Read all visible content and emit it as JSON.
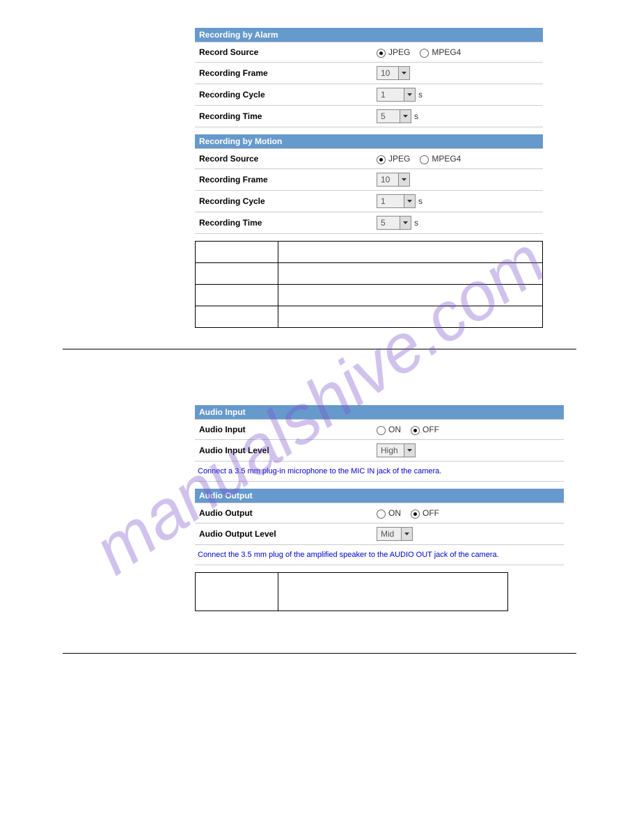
{
  "watermark": "manualshive.com",
  "section1": {
    "title": "Recording by Alarm",
    "rows": {
      "record_source": {
        "label": "Record Source",
        "opt1": "JPEG",
        "opt2": "MPEG4",
        "selected": "JPEG"
      },
      "recording_frame": {
        "label": "Recording Frame",
        "value": "10"
      },
      "recording_cycle": {
        "label": "Recording Cycle",
        "value": "1",
        "suffix": "s"
      },
      "recording_time": {
        "label": "Recording Time",
        "value": "5",
        "suffix": "s"
      }
    }
  },
  "section2": {
    "title": "Recording by Motion",
    "rows": {
      "record_source": {
        "label": "Record Source",
        "opt1": "JPEG",
        "opt2": "MPEG4",
        "selected": "JPEG"
      },
      "recording_frame": {
        "label": "Recording Frame",
        "value": "10"
      },
      "recording_cycle": {
        "label": "Recording Cycle",
        "value": "1",
        "suffix": "s"
      },
      "recording_time": {
        "label": "Recording Time",
        "value": "5",
        "suffix": "s"
      }
    }
  },
  "section3": {
    "title": "Audio Input",
    "rows": {
      "audio_input": {
        "label": "Audio Input",
        "opt1": "ON",
        "opt2": "OFF",
        "selected": "OFF"
      },
      "audio_input_level": {
        "label": "Audio Input Level",
        "value": "High"
      },
      "note": "Connect a 3.5 mm plug-in microphone to the MIC IN jack of the camera."
    }
  },
  "section4": {
    "title": "Audio Output",
    "rows": {
      "audio_output": {
        "label": "Audio Output",
        "opt1": "ON",
        "opt2": "OFF",
        "selected": "OFF"
      },
      "audio_output_level": {
        "label": "Audio Output Level",
        "value": "Mid"
      },
      "note": "Connect the 3.5 mm plug of the amplified speaker to the AUDIO OUT jack of the camera."
    }
  }
}
